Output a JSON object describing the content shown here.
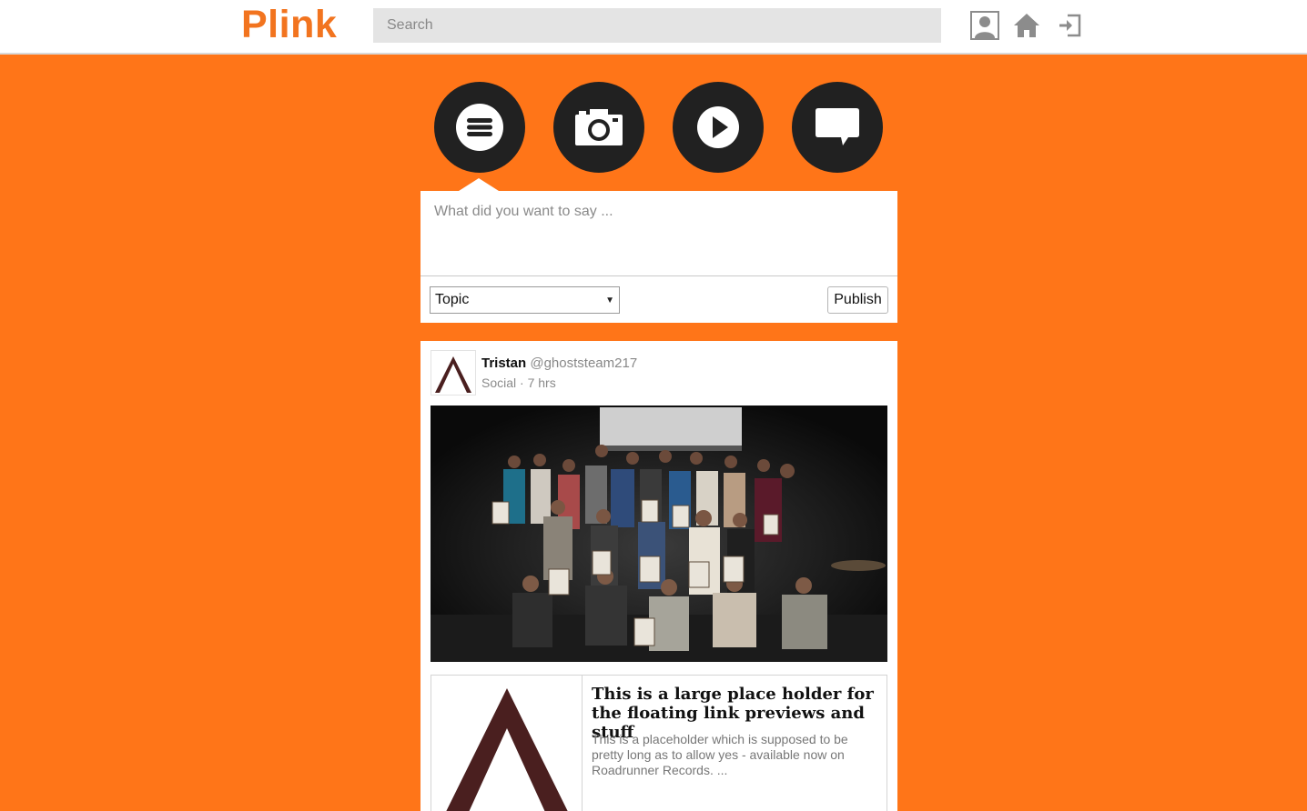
{
  "header": {
    "logo": "Plink",
    "search_placeholder": "Search",
    "icons": [
      "profile-icon",
      "home-icon",
      "logout-icon"
    ]
  },
  "post_types": [
    {
      "name": "text-post-button",
      "icon": "menu-lines-icon"
    },
    {
      "name": "photo-post-button",
      "icon": "camera-icon"
    },
    {
      "name": "video-post-button",
      "icon": "play-icon"
    },
    {
      "name": "chat-post-button",
      "icon": "speech-bubble-icon"
    }
  ],
  "composer": {
    "placeholder": "What did you want to say ...",
    "topic_selected": "Topic",
    "publish_label": "Publish"
  },
  "post": {
    "author_name": "Tristan",
    "author_handle": "@ghoststeam217",
    "topic": "Social",
    "separator": "·",
    "time": "7 hrs",
    "link_preview": {
      "title": "This is a large place holder for the floating link previews and stuff",
      "description": "This is a placeholder which is supposed to be pretty long as to allow yes - available now on Roadrunner Records. ..."
    }
  },
  "colors": {
    "brand_orange": "#ff7518",
    "logo_orange": "#f2741f",
    "button_dark": "#212121",
    "avatar_brown": "#4a1f1f"
  }
}
